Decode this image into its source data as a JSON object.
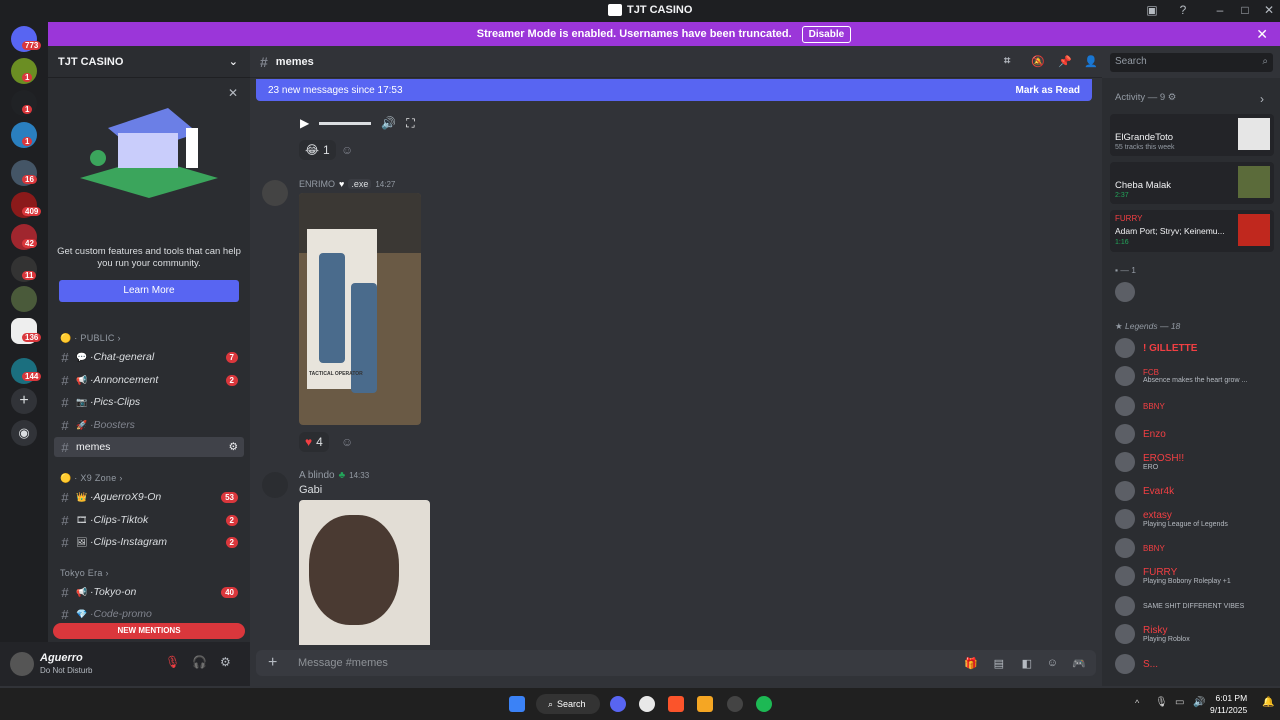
{
  "window": {
    "title": "TJT CASINO"
  },
  "banner": {
    "text": "Streamer Mode is enabled. Usernames have been truncated.",
    "button": "Disable"
  },
  "servers": {
    "badges": [
      "773",
      "1",
      "1",
      "1",
      "16",
      "409",
      "42",
      "11",
      "136",
      "144"
    ]
  },
  "server": {
    "name": "TJT CASINO"
  },
  "promo": {
    "text": "Get custom features and tools that can help you run your community.",
    "button": "Learn More"
  },
  "categories": [
    {
      "name": "PUBLIC"
    },
    {
      "name": "X9 Zone"
    },
    {
      "name": "Tokyo Era"
    }
  ],
  "channels": [
    {
      "name": "Chat-general",
      "badge": "7"
    },
    {
      "name": "Annoncement",
      "badge": "2"
    },
    {
      "name": "Pics-Clips",
      "badge": ""
    },
    {
      "name": "Boosters",
      "badge": ""
    },
    {
      "name": "memes",
      "badge": ""
    },
    {
      "name": "AguerroX9-On",
      "badge": "53"
    },
    {
      "name": "Clips-Tiktok",
      "badge": "2"
    },
    {
      "name": "Clips-Instagram",
      "badge": "2"
    },
    {
      "name": "Tokyo-on",
      "badge": "40"
    },
    {
      "name": "Code-promo",
      "badge": ""
    }
  ],
  "new_mentions": "NEW MENTIONS",
  "user": {
    "name": "Aguerro",
    "status": "Do Not Disturb"
  },
  "channel": {
    "name": "memes",
    "new_messages": "23 new messages since 17:53",
    "mark_read": "Mark as Read"
  },
  "search": {
    "placeholder": "Search"
  },
  "messages": [
    {
      "reaction_count": "1"
    },
    {
      "author": "ENRIMO",
      "tag": ".exe",
      "time": "14:27",
      "reaction_count": "4",
      "image_caption": "TACTICAL OPERATOR"
    },
    {
      "author": "A blindo",
      "time": "14:33",
      "text": "Gabi"
    }
  ],
  "composer": {
    "placeholder": "Message #memes"
  },
  "activity": {
    "header": "Activity — 9",
    "items": [
      {
        "name": "ElGrandeToto",
        "detail": "55 tracks this week"
      },
      {
        "name": "Cheba Malak",
        "detail": "2:37"
      },
      {
        "name": "FURRY",
        "detail": "Adam Port; Stryv; Keinemu...",
        "time": "1:16"
      }
    ]
  },
  "member_groups": [
    {
      "name": "— 1"
    },
    {
      "name": "Legends — 18"
    }
  ],
  "members": [
    {
      "name": "! GILLETTE",
      "sub": "",
      "color": "#f23f43"
    },
    {
      "name": "FCB",
      "sub": "Absence makes the heart grow ...",
      "color": "#f23f43"
    },
    {
      "name": "BBNY",
      "sub": "",
      "color": "#f23f43"
    },
    {
      "name": "Enzo",
      "sub": "",
      "color": "#f23f43"
    },
    {
      "name": "EROSH!!",
      "sub": "ERO",
      "color": "#f23f43"
    },
    {
      "name": "Evar4k",
      "sub": "",
      "color": "#f23f43"
    },
    {
      "name": "extasy",
      "sub": "Playing League of Legends",
      "color": "#f23f43"
    },
    {
      "name": "BBNY",
      "sub": "",
      "color": "#f23f43"
    },
    {
      "name": "FURRY",
      "sub": "Playing Bobony Roleplay +1",
      "color": "#f23f43"
    },
    {
      "name": "",
      "sub": "SAME SHIT DIFFERENT VIBES",
      "color": "#f23f43"
    },
    {
      "name": "Risky",
      "sub": "Playing Roblox",
      "color": "#f23f43"
    },
    {
      "name": "S...",
      "sub": "",
      "color": "#f23f43"
    }
  ],
  "taskbar": {
    "search": "Search",
    "time": "6:01 PM",
    "date": "9/11/2025"
  }
}
